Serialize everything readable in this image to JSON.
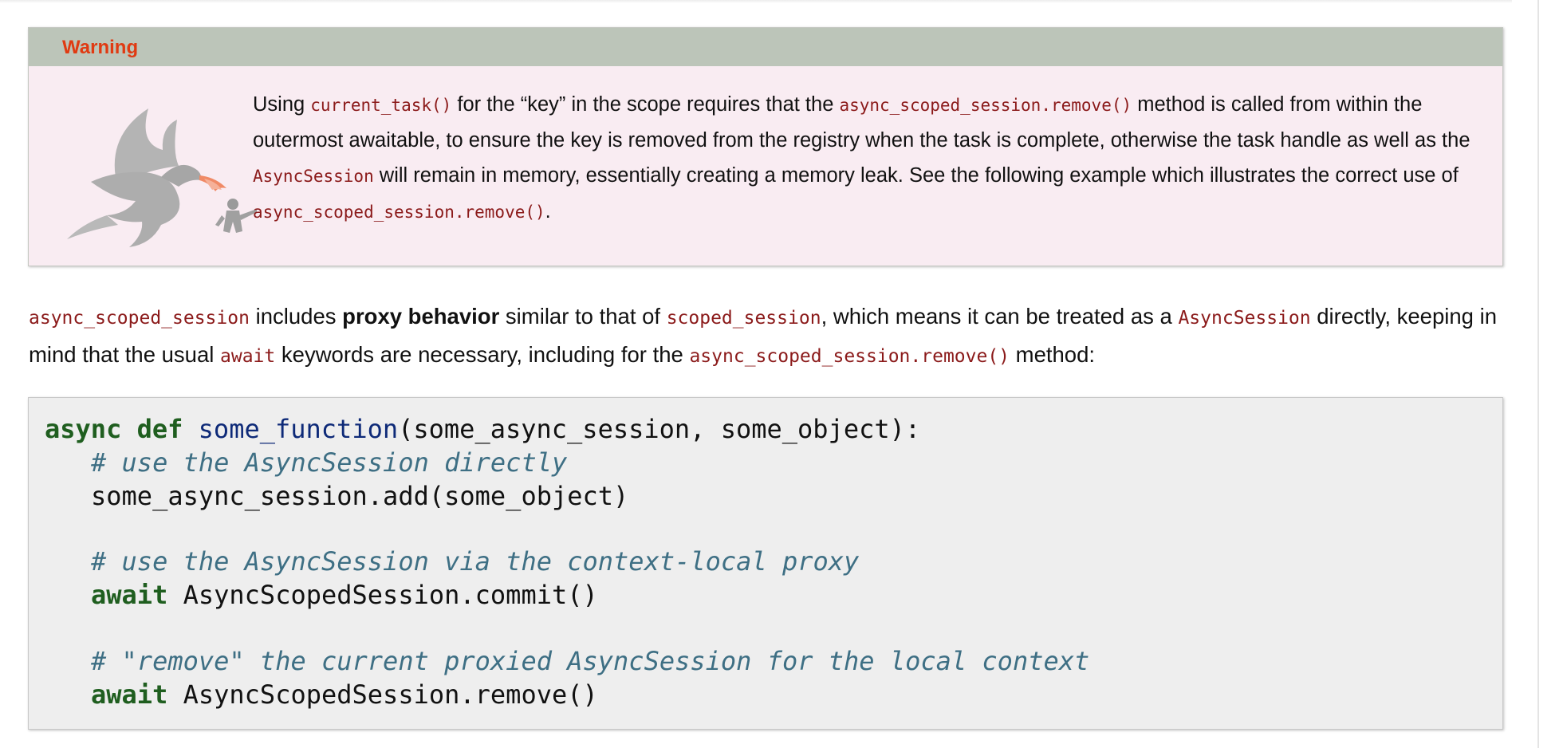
{
  "warning": {
    "title": "Warning",
    "text_parts": [
      "Using ",
      "current_task()",
      " for the “key” in the scope requires that the ",
      "async_scoped_session.remove()",
      " method is called from within the outermost awaitable, to ensure the key is removed from the registry when the task is complete, otherwise the task handle as well as the ",
      "AsyncSession",
      " will remain in memory, essentially creating a memory leak. See the following example which illustrates the correct use of ",
      "async_scoped_session.remove()",
      "."
    ],
    "colors": {
      "title": "#e03a12",
      "header_bg": "#bcc5b9",
      "body_bg": "#f9ecf2"
    }
  },
  "paragraph": {
    "parts": [
      "async_scoped_session",
      " includes ",
      "proxy behavior",
      " similar to that of ",
      "scoped_session",
      ", which means it can be treated as a ",
      "AsyncSession",
      " directly, keeping in mind that the usual ",
      "await",
      " keywords are necessary, including for the ",
      "async_scoped_session.remove()",
      " method:"
    ]
  },
  "code": {
    "line1": {
      "kw1": "async",
      "kw2": "def",
      "fn": "some_function",
      "rest": "(some_async_session, some_object):"
    },
    "line2": {
      "comment": "# use the AsyncSession directly"
    },
    "line3": {
      "text": "some_async_session.add(some_object)"
    },
    "line5": {
      "comment": "# use the AsyncSession via the context-local proxy"
    },
    "line6": {
      "kw": "await",
      "text": "AsyncScopedSession.commit()"
    },
    "line8": {
      "comment": "# \"remove\" the current proxied AsyncSession for the local context"
    },
    "line9": {
      "kw": "await",
      "text": "AsyncScopedSession.remove()"
    },
    "colors": {
      "keyword": "#1f5e1f",
      "function": "#0e2a78",
      "comment": "#3e6f84",
      "background": "#eeeeee"
    }
  },
  "icons": {
    "dragon": "dragon-mascot-icon"
  }
}
